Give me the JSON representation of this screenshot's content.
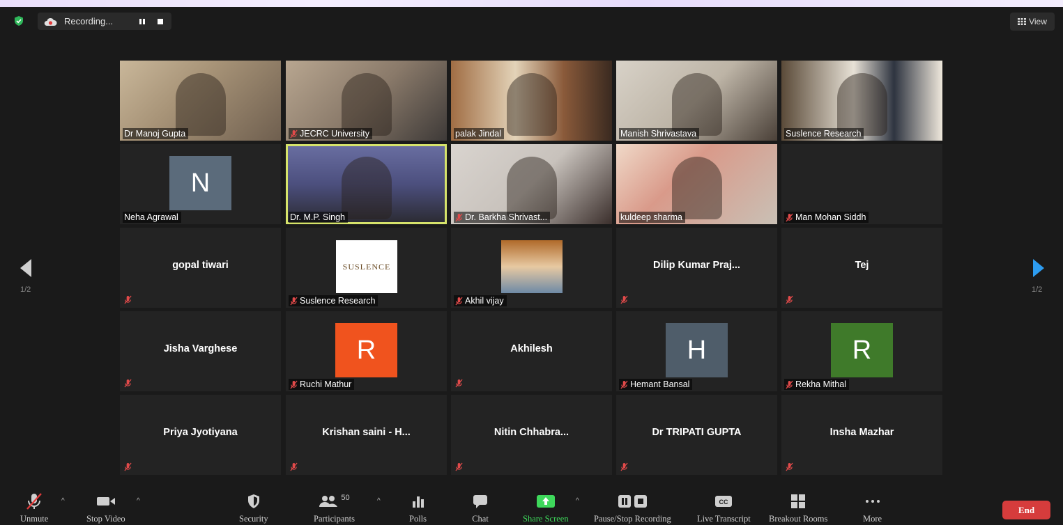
{
  "recording": {
    "label": "Recording..."
  },
  "view_button": {
    "label": "View"
  },
  "navigation": {
    "left_page": "1/2",
    "right_page": "1/2"
  },
  "tiles": [
    {
      "name": "Dr Manoj Gupta",
      "type": "video",
      "muted": false
    },
    {
      "name": "JECRC University",
      "type": "video",
      "muted": true
    },
    {
      "name": "palak Jindal",
      "type": "video",
      "muted": false
    },
    {
      "name": "Manish Shrivastava",
      "type": "video",
      "muted": false
    },
    {
      "name": "Suslence Research",
      "type": "video",
      "muted": false
    },
    {
      "name": "Neha Agrawal",
      "type": "avatar",
      "initial": "N",
      "avatar_color": "#5b6b7b",
      "muted": false
    },
    {
      "name": "Dr. M.P. Singh",
      "type": "video",
      "muted": false,
      "active_speaker": true
    },
    {
      "name": "Dr. Barkha Shrivast...",
      "type": "video",
      "muted": true
    },
    {
      "name": "kuldeep sharma",
      "type": "video",
      "muted": false
    },
    {
      "name": "Man Mohan Siddh",
      "type": "blank",
      "muted": true
    },
    {
      "name": "gopal tiwari",
      "type": "text",
      "muted": true
    },
    {
      "name": "Suslence Research",
      "type": "logo",
      "logo_text": "SUSLENCE",
      "muted": true
    },
    {
      "name": "Akhil vijay",
      "type": "photo",
      "muted": true
    },
    {
      "name": "Dilip Kumar Praj...",
      "type": "text",
      "muted": true
    },
    {
      "name": "Tej",
      "type": "text",
      "muted": true
    },
    {
      "name": "Jisha Varghese",
      "type": "text",
      "muted": true
    },
    {
      "name": "Ruchi Mathur",
      "type": "avatar",
      "initial": "R",
      "avatar_color": "#f0531e",
      "muted": true
    },
    {
      "name": "Akhilesh",
      "type": "text",
      "muted": true
    },
    {
      "name": "Hemant Bansal",
      "type": "avatar",
      "initial": "H",
      "avatar_color": "#4f5d6a",
      "muted": true
    },
    {
      "name": "Rekha Mithal",
      "type": "avatar",
      "initial": "R",
      "avatar_color": "#3f7a2a",
      "muted": true
    },
    {
      "name": "Priya Jyotiyana",
      "type": "text",
      "muted": true
    },
    {
      "name": "Krishan saini - H...",
      "type": "text",
      "muted": true
    },
    {
      "name": "Nitin  Chhabra...",
      "type": "text",
      "muted": true
    },
    {
      "name": "Dr TRIPATI GUPTA",
      "type": "text",
      "muted": true
    },
    {
      "name": "Insha Mazhar",
      "type": "text",
      "muted": true
    }
  ],
  "toolbar": {
    "unmute": "Unmute",
    "stop_video": "Stop Video",
    "security": "Security",
    "participants": "Participants",
    "participants_count": "50",
    "polls": "Polls",
    "chat": "Chat",
    "share_screen": "Share Screen",
    "pause_stop_recording": "Pause/Stop Recording",
    "live_transcript": "Live Transcript",
    "breakout_rooms": "Breakout Rooms",
    "more": "More",
    "end": "End"
  },
  "colors": {
    "share_green": "#3ed85b",
    "end_red": "#d63c3c",
    "active_speaker": "#d6e36b"
  }
}
